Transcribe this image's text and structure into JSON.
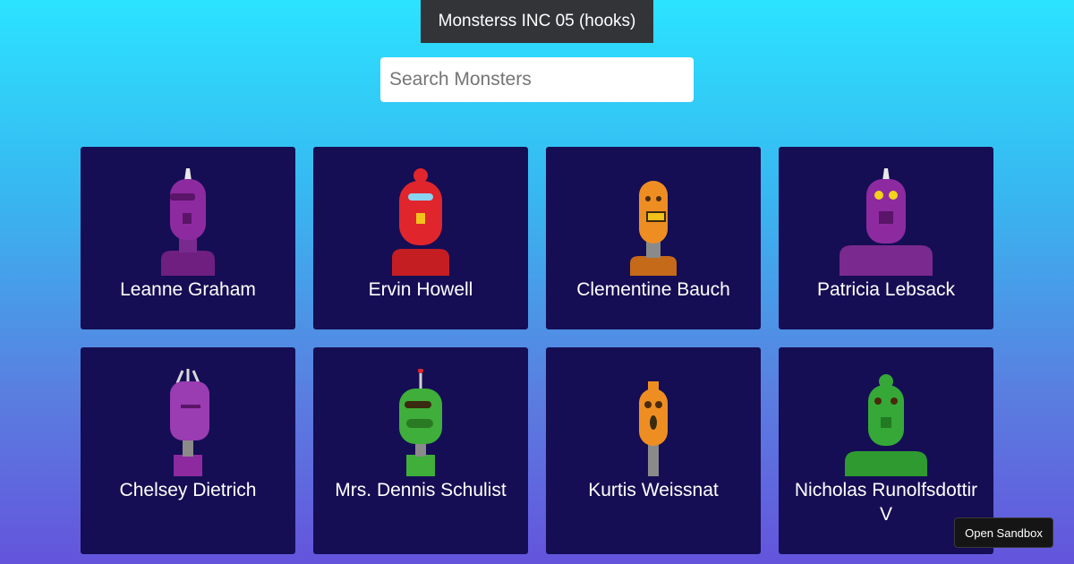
{
  "header": {
    "title": "Monsterss INC 05 (hooks)"
  },
  "search": {
    "placeholder": "Search Monsters",
    "value": ""
  },
  "monsters": [
    {
      "name": "Leanne Graham",
      "icon": "purple-robot-avatar",
      "color": "#8e2aa0"
    },
    {
      "name": "Ervin Howell",
      "icon": "red-robot-avatar",
      "color": "#e0262c"
    },
    {
      "name": "Clementine Bauch",
      "icon": "orange-robot-avatar",
      "color": "#ee8e22"
    },
    {
      "name": "Patricia Lebsack",
      "icon": "purple-robot-avatar",
      "color": "#8e2aa0"
    },
    {
      "name": "Chelsey Dietrich",
      "icon": "purple-robot-avatar",
      "color": "#9a3cb2"
    },
    {
      "name": "Mrs. Dennis Schulist",
      "icon": "green-robot-avatar",
      "color": "#3fae3a"
    },
    {
      "name": "Kurtis Weissnat",
      "icon": "orange-robot-avatar",
      "color": "#ee8e22"
    },
    {
      "name": "Nicholas Runolfsdottir V",
      "icon": "green-robot-avatar",
      "color": "#35a838"
    }
  ],
  "footer": {
    "open_sandbox_label": "Open Sandbox"
  }
}
